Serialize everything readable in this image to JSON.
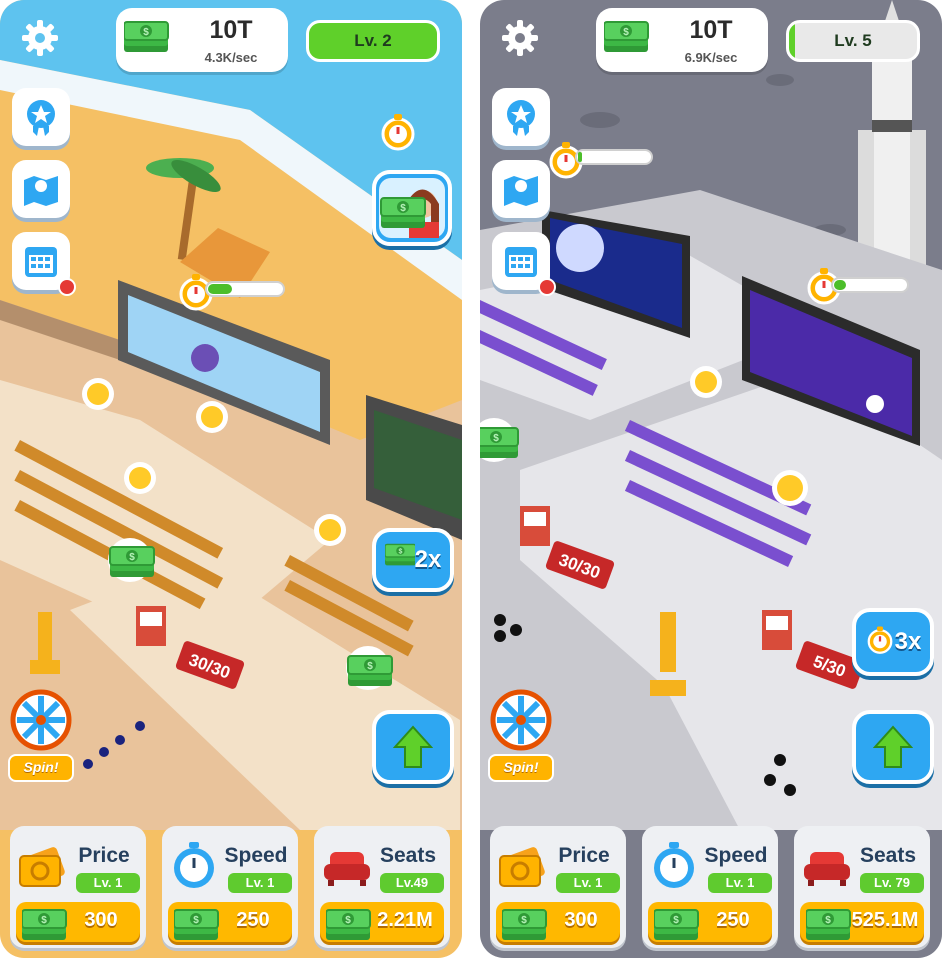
{
  "screens": [
    {
      "id": "left",
      "money": "10T",
      "rate": "4.3K/sec",
      "level": "Lv. 2",
      "level_progress": 1.0,
      "boost_multiplier": "2x",
      "spin_label": "Spin!",
      "ticket_booth_count": "30/30",
      "cards": [
        {
          "title": "Price",
          "level": "Lv. 1",
          "cost": "300"
        },
        {
          "title": "Speed",
          "level": "Lv. 1",
          "cost": "250"
        },
        {
          "title": "Seats",
          "level": "Lv.49",
          "cost": "2.21M"
        }
      ]
    },
    {
      "id": "right",
      "money": "10T",
      "rate": "6.9K/sec",
      "level": "Lv. 5",
      "level_progress": 0.05,
      "boost_multiplier": "3x",
      "spin_label": "Spin!",
      "ticket_booth_counts": [
        "30/30",
        "5/30"
      ],
      "cards": [
        {
          "title": "Price",
          "level": "Lv. 1",
          "cost": "300"
        },
        {
          "title": "Speed",
          "level": "Lv. 1",
          "cost": "250"
        },
        {
          "title": "Seats",
          "level": "Lv. 79",
          "cost": "525.1M"
        }
      ]
    }
  ],
  "icons": [
    "gear-icon",
    "cash-icon",
    "award-icon",
    "map-icon",
    "calendar-icon",
    "stopwatch-icon",
    "manager-avatar",
    "spin-wheel-icon",
    "up-arrow-icon",
    "ticket-icon",
    "seat-icon",
    "rocket",
    "emoji-crying",
    "emoji-laughing",
    "emoji-heart-eyes"
  ],
  "colors": {
    "accent_green": "#5fd02a",
    "button_blue": "#2ea7f2",
    "buy_orange": "#ffb800",
    "beach_sand": "#f5c064",
    "sea_blue": "#5ec3ef",
    "moon_gray": "#7b7d8b"
  }
}
